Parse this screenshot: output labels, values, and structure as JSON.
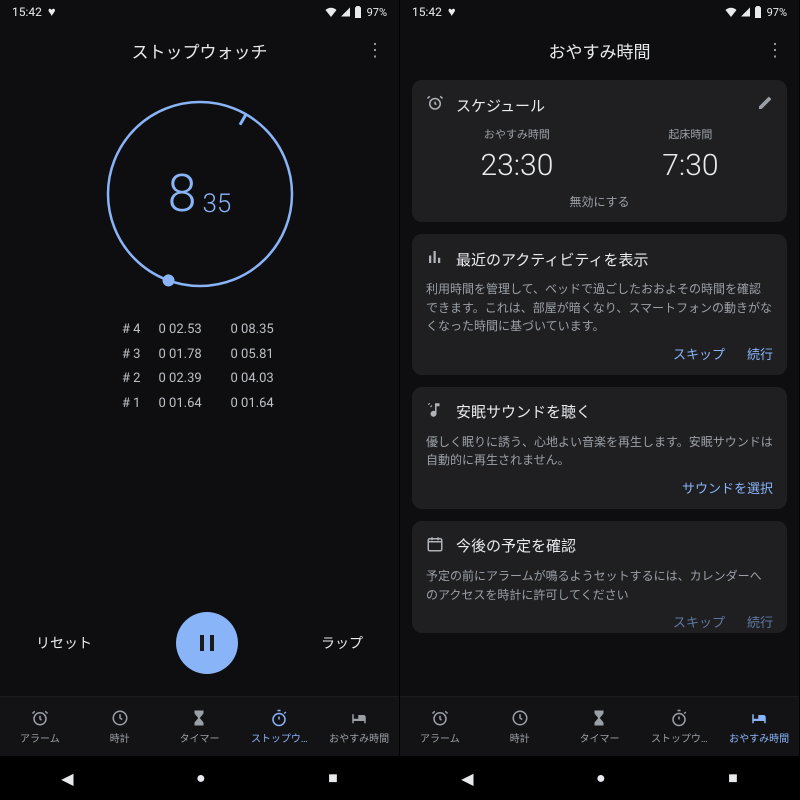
{
  "status": {
    "time": "15:42",
    "battery": "97%"
  },
  "left": {
    "title": "ストップウォッチ",
    "seconds": "8",
    "hundredths": "35",
    "laps": [
      {
        "idx": "# 4",
        "split": "0 02.53",
        "total": "0 08.35"
      },
      {
        "idx": "# 3",
        "split": "0 01.78",
        "total": "0 05.81"
      },
      {
        "idx": "# 2",
        "split": "0 02.39",
        "total": "0 04.03"
      },
      {
        "idx": "# 1",
        "split": "0 01.64",
        "total": "0 01.64"
      }
    ],
    "reset": "リセット",
    "lap": "ラップ",
    "active_tab": 3
  },
  "right": {
    "title": "おやすみ時間",
    "schedule": {
      "header": "スケジュール",
      "bed_label": "おやすみ時間",
      "bed_time": "23:30",
      "wake_label": "起床時間",
      "wake_time": "7:30",
      "disable": "無効にする"
    },
    "activity": {
      "header": "最近のアクティビティを表示",
      "body": "利用時間を管理して、ベッドで過ごしたおおよその時間を確認できます。これは、部屋が暗くなり、スマートフォンの動きがなくなった時間に基づいています。",
      "skip": "スキップ",
      "cont": "続行"
    },
    "sounds": {
      "header": "安眠サウンドを聴く",
      "body": "優しく眠りに誘う、心地よい音楽を再生します。安眠サウンドは自動的に再生されません。",
      "choose": "サウンドを選択"
    },
    "calendar": {
      "header": "今後の予定を確認",
      "body": "予定の前にアラームが鳴るようセットするには、カレンダーへのアクセスを時計に許可してください",
      "skip": "スキップ",
      "cont": "続行"
    },
    "active_tab": 4
  },
  "tabs": [
    "アラーム",
    "時計",
    "タイマー",
    "ストップウ…",
    "おやすみ時間"
  ]
}
